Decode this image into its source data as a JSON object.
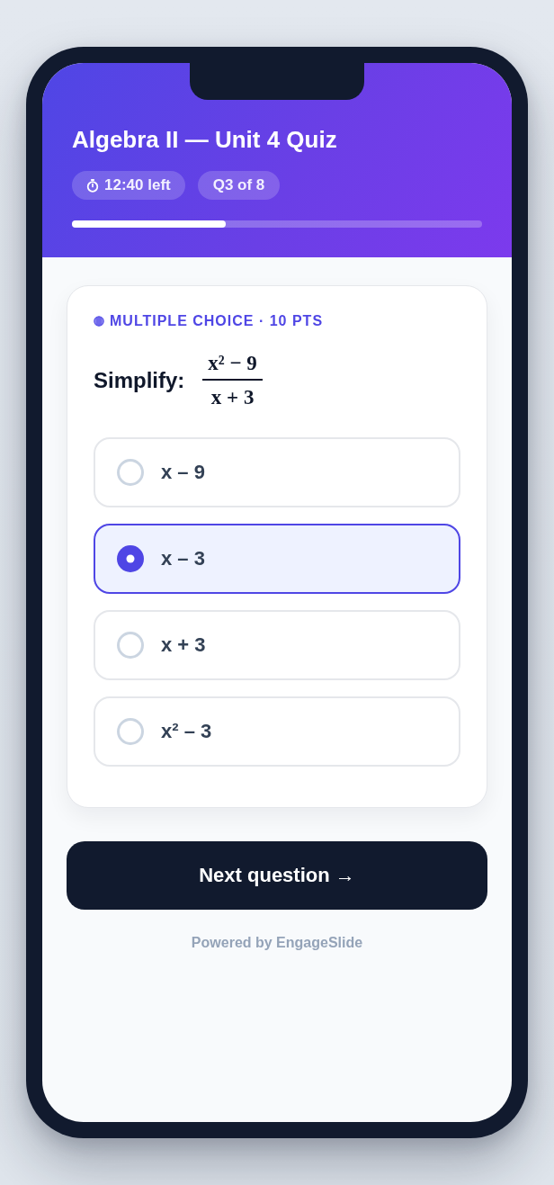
{
  "quiz": {
    "title": "Algebra II — Unit 4 Quiz",
    "timer": "12:40 left",
    "question_counter": "Q3 of 8",
    "progress": {
      "level": 0.375
    }
  },
  "question": {
    "type_label": "MULTIPLE CHOICE · 10 PTS",
    "prompt": "Simplify:",
    "numerator": "x² − 9",
    "denominator": "x + 3"
  },
  "options": [
    {
      "label": "x – 9",
      "selected": false
    },
    {
      "label": "x – 3",
      "selected": true
    },
    {
      "label": "x + 3",
      "selected": false
    },
    {
      "label": "x² – 3",
      "selected": false
    }
  ],
  "next_button": "Next question →",
  "footer": "Powered by EngageSlide"
}
